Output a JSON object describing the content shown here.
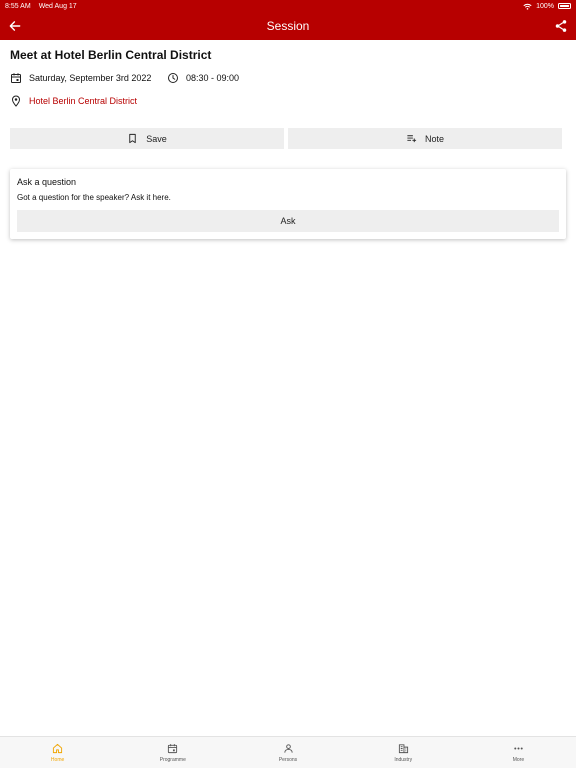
{
  "status_bar": {
    "time": "8:55 AM",
    "date": "Wed Aug 17",
    "battery": "100%"
  },
  "app_bar": {
    "title": "Session"
  },
  "session": {
    "title": "Meet at Hotel Berlin Central District",
    "date": "Saturday, September 3rd 2022",
    "time": "08:30 - 09:00",
    "location": "Hotel Berlin Central District"
  },
  "actions": {
    "save_label": "Save",
    "note_label": "Note"
  },
  "question": {
    "title": "Ask a question",
    "description": "Got a question for the speaker? Ask it here.",
    "ask_label": "Ask"
  },
  "tabs": [
    {
      "label": "Home",
      "icon": "home-icon",
      "active": true
    },
    {
      "label": "Programme",
      "icon": "calendar-icon",
      "active": false
    },
    {
      "label": "Persons",
      "icon": "person-icon",
      "active": false
    },
    {
      "label": "Industry",
      "icon": "building-icon",
      "active": false
    },
    {
      "label": "More",
      "icon": "more-icon",
      "active": false
    }
  ],
  "colors": {
    "brand": "#b70000",
    "active_tab": "#f0a500",
    "button_bg": "#eeeeee"
  }
}
